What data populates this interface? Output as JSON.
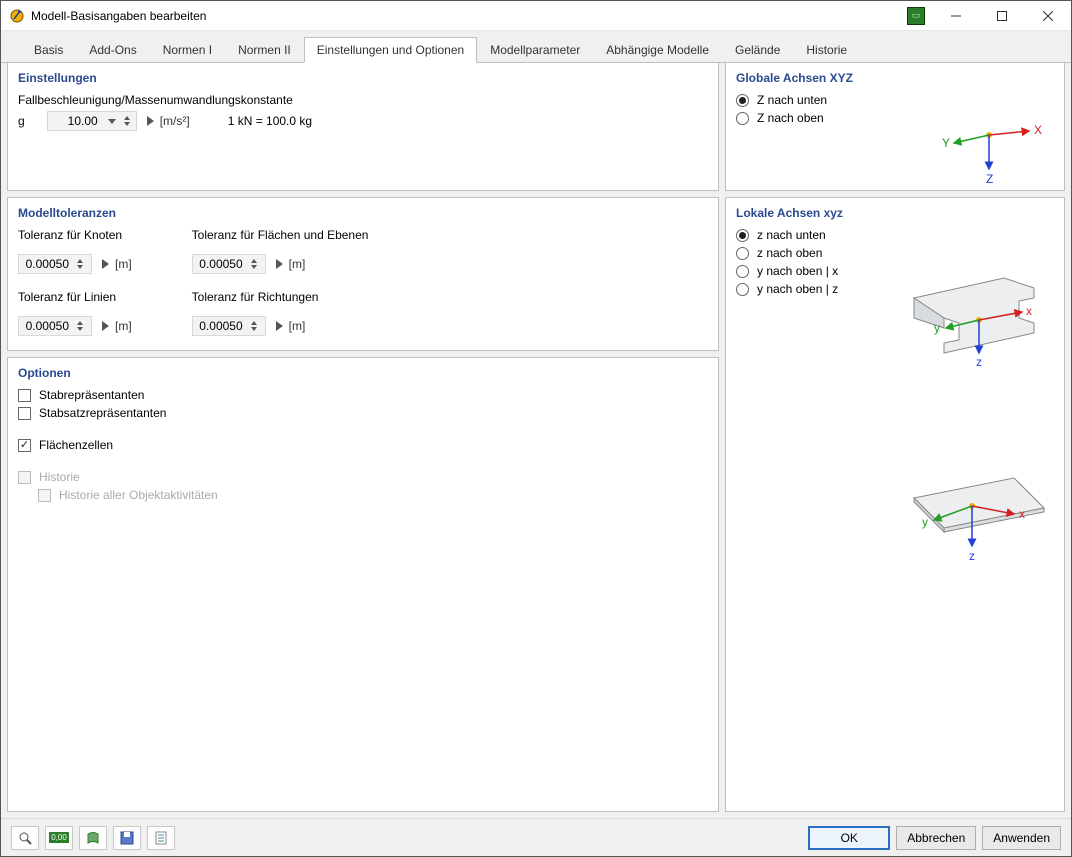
{
  "window": {
    "title": "Modell-Basisangaben bearbeiten"
  },
  "tabs": {
    "items": [
      "Basis",
      "Add-Ons",
      "Normen I",
      "Normen II",
      "Einstellungen und Optionen",
      "Modellparameter",
      "Abhängige Modelle",
      "Gelände",
      "Historie"
    ],
    "active_index": 4
  },
  "einstellungen": {
    "title": "Einstellungen",
    "line1": "Fallbeschleunigung/Massenumwandlungskonstante",
    "g_label": "g",
    "g_value": "10.00",
    "g_unit": "[m/s²]",
    "kn_text": "1 kN = 100.0 kg"
  },
  "modelltoleranzen": {
    "title": "Modelltoleranzen",
    "knoten_label": "Toleranz für Knoten",
    "knoten_value": "0.00050",
    "linien_label": "Toleranz für Linien",
    "linien_value": "0.00050",
    "flaechen_label": "Toleranz für Flächen und Ebenen",
    "flaechen_value": "0.00050",
    "richtungen_label": "Toleranz für Richtungen",
    "richtungen_value": "0.00050",
    "unit": "[m]"
  },
  "optionen": {
    "title": "Optionen",
    "stabrepr": "Stabrepräsentanten",
    "stabsatz": "Stabsatzrepräsentanten",
    "flaechenzellen": "Flächenzellen",
    "historie": "Historie",
    "hist_all": "Historie aller Objektaktivitäten",
    "checked": {
      "stabrepr": false,
      "stabsatz": false,
      "flaechenzellen": true,
      "historie": false,
      "hist_all": false
    }
  },
  "globale": {
    "title": "Globale Achsen XYZ",
    "opt1": "Z nach unten",
    "opt2": "Z nach oben",
    "selected": 0,
    "axes": {
      "x": "X",
      "y": "Y",
      "z": "Z"
    }
  },
  "lokale": {
    "title": "Lokale Achsen xyz",
    "opt1": "z nach unten",
    "opt2": "z nach oben",
    "opt3": "y nach oben | x",
    "opt4": "y nach oben | z",
    "selected": 0,
    "axes": {
      "x": "x",
      "y": "y",
      "z": "z"
    }
  },
  "footer": {
    "ok": "OK",
    "abbrechen": "Abbrechen",
    "anwenden": "Anwenden"
  }
}
